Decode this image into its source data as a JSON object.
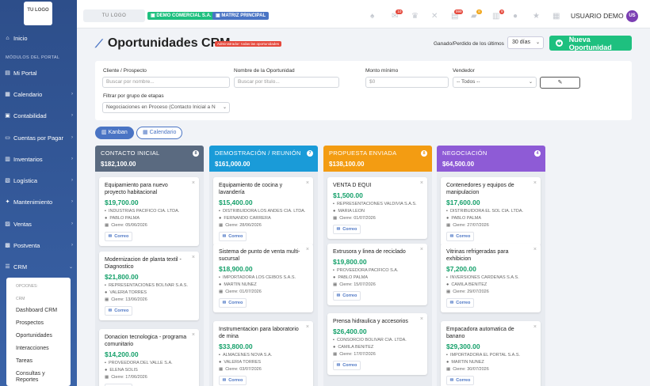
{
  "sidebar": {
    "logo_text": "TU LOGO",
    "items": [
      {
        "label": "Inicio",
        "icon": "home-icon"
      },
      {
        "label": "Mi Portal",
        "icon": "portal-icon"
      },
      {
        "label": "Calendario",
        "icon": "calendar-icon"
      },
      {
        "label": "Contabilidad",
        "icon": "accounting-icon"
      },
      {
        "label": "Cuentas por Pagar",
        "icon": "payables-icon"
      },
      {
        "label": "Inventarios",
        "icon": "inventory-icon"
      },
      {
        "label": "Logística",
        "icon": "logistics-icon"
      },
      {
        "label": "Mantenimiento",
        "icon": "maintenance-icon"
      },
      {
        "label": "Ventas",
        "icon": "sales-icon"
      },
      {
        "label": "Postventa",
        "icon": "postsale-icon"
      },
      {
        "label": "CRM",
        "icon": "crm-icon"
      }
    ],
    "section_label": "MÓDULOS DEL PORTAL",
    "submenu": {
      "caption_options": "OPCIONES:",
      "caption_crm": "CRM",
      "items": [
        "Dashboard CRM",
        "Prospectos",
        "Oportunidades",
        "Interacciones",
        "Tareas",
        "Consultas y Reportes"
      ]
    }
  },
  "topbar": {
    "logo_text": "TU LOGO",
    "company_badge": "DEMO COMERCIAL S.A.",
    "branch_badge": "MATRIZ PRINCIPAL",
    "notification_counts": [
      "",
      "10",
      "",
      "",
      "999",
      "8",
      "9",
      "",
      ""
    ],
    "user_name": "USUARIO DEMO",
    "avatar_initials": "US"
  },
  "page": {
    "title": "Oportunidades CRM",
    "admin_badge": "Administrador: todas las oportunidades",
    "gp_label": "Ganado/Perdido de los últimos",
    "gp_value": "30 días",
    "new_button": "Nueva Oportunidad"
  },
  "filters": {
    "client_label": "Cliente / Prospecto",
    "client_placeholder": "Buscar por nombre...",
    "opp_label": "Nombre de la Oportunidad",
    "opp_placeholder": "Buscar por título...",
    "min_label": "Monto mínimo",
    "min_placeholder": "$0",
    "seller_label": "Vendedor",
    "seller_value": "-- Todos --",
    "stage_group_label": "Filtrar por grupo de etapas",
    "stage_group_value": "Negociaciones en Proceso (Contacto Inicial a N"
  },
  "views": {
    "kanban": "Kanban",
    "calendar": "Calendario"
  },
  "columns": [
    {
      "name": "CONTACTO INICIAL",
      "total": "$182,100.00",
      "count": "8",
      "color": "#5a6a80",
      "cards": [
        {
          "title": "Equipamiento para nuevo proyecto habitacional",
          "amount": "$19,700.00",
          "company": "INDUSTRIAS PACIFICO CIA. LTDA.",
          "contact": "PABLO PALMA",
          "close": "Cierre: 05/06/2026",
          "btn": "Correo"
        },
        {
          "title": "Modernizacion de planta textil - Diagnostico",
          "amount": "$21,800.00",
          "company": "REPRESENTACIONES BOLIVAR S.A.S.",
          "contact": "VALERIA TORRES",
          "close": "Cierre: 13/06/2026",
          "btn": "Correo"
        },
        {
          "title": "Donacion tecnologica - programa comunitario",
          "amount": "$14,200.00",
          "company": "PROVEEDORA DEL VALLE S.A.",
          "contact": "ELENA SOLIS",
          "close": "Cierre: 17/06/2026",
          "btn": "Correo"
        }
      ]
    },
    {
      "name": "DEMOSTRACIÓN / REUNIÓN",
      "total": "$161,000.00",
      "count": "7",
      "color": "#1a9bd8",
      "cards": [
        {
          "title": "Equipamiento de cocina y lavandería",
          "amount": "$15,400.00",
          "company": "DISTRIBUIDORA LOS ANDES CIA. LTDA.",
          "contact": "FERNANDO CARRERA",
          "close": "Cierre: 28/06/2026",
          "btn": "Correo"
        },
        {
          "title": "Sistema de punto de venta multi-sucursal",
          "amount": "$18,900.00",
          "company": "IMPORTADORA LOS CEIBOS S.A.S.",
          "contact": "MARTIN NUNEZ",
          "close": "Cierre: 01/07/2026",
          "btn": "Correo"
        },
        {
          "title": "Instrumentacion para laboratorio de mina",
          "amount": "$33,800.00",
          "company": "ALMACENES NOVA S.A.",
          "contact": "VALERIA TORRES",
          "close": "Cierre: 03/07/2026",
          "btn": "Correo"
        }
      ]
    },
    {
      "name": "PROPUESTA ENVIADA",
      "total": "$138,100.00",
      "count": "8",
      "color": "#f39c12",
      "cards": [
        {
          "title": "VENTA D EQUI",
          "amount": "$1,500.00",
          "company": "REPRESENTACIONES VALDIVIA S.A.S.",
          "contact": "MARIA LEON",
          "close": "Cierre: 01/07/2026",
          "btn": "Correo"
        },
        {
          "title": "Extrusora y linea de reciclado",
          "amount": "$19,800.00",
          "company": "PROVEEDORA PACIFICO S.A.",
          "contact": "PABLO PALMA",
          "close": "Cierre: 15/07/2026",
          "btn": "Correo"
        },
        {
          "title": "Prensa hidraulica y accesorios",
          "amount": "$26,400.00",
          "company": "CONSORCIO BOLIVAR CIA. LTDA.",
          "contact": "CAMILA BENITEZ",
          "close": "Cierre: 17/07/2026",
          "btn": "Correo"
        }
      ]
    },
    {
      "name": "NEGOCIACIÓN",
      "total": "$64,500.00",
      "count": "4",
      "color": "#8e5bd6",
      "cards": [
        {
          "title": "Contenedores y equipos de manipulacion",
          "amount": "$17,600.00",
          "company": "DISTRIBUIDORA EL SOL CIA. LTDA.",
          "contact": "PABLO PALMA",
          "close": "Cierre: 27/07/2026",
          "btn": "Correo"
        },
        {
          "title": "Vitrinas refrigeradas para exhibicion",
          "amount": "$7,200.00",
          "company": "INVERSIONES CARDENAS S.A.S.",
          "contact": "CAMILA BENITEZ",
          "close": "Cierre: 29/07/2026",
          "btn": "Correo"
        },
        {
          "title": "Empacadora automatica de banano",
          "amount": "$29,300.00",
          "company": "IMPORTADORA EL PORTAL S.A.S.",
          "contact": "MARTIN NUNEZ",
          "close": "Cierre: 30/07/2026",
          "btn": "Correo"
        }
      ]
    }
  ]
}
